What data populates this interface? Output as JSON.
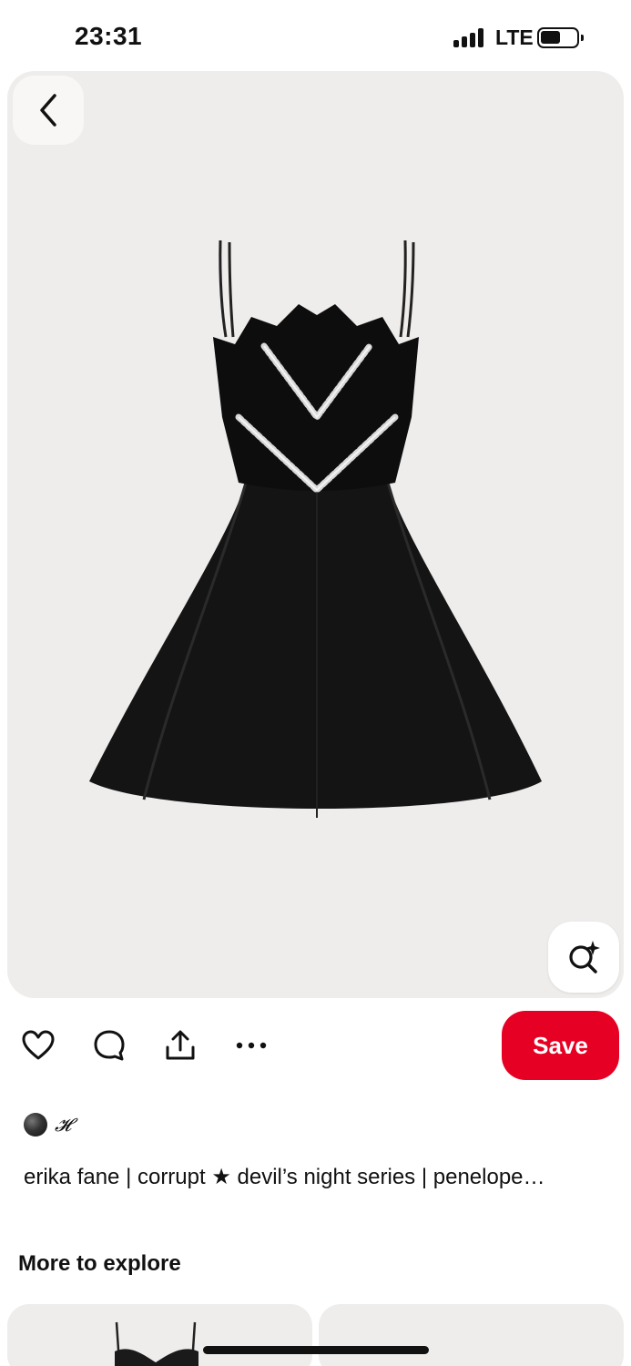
{
  "status_bar": {
    "time": "23:31",
    "network": "LTE",
    "battery_level": 0.55
  },
  "pin": {
    "image_alt": "black mini dress with zigzag bodice and crystal leaf embellishment",
    "author": {
      "name": "𝓗"
    },
    "title": "erika fane | corrupt ★ devil’s night series | penelope…",
    "save_label": "Save"
  },
  "actions": {
    "icons": [
      "heart-icon",
      "comment-icon",
      "share-icon",
      "more-icon"
    ]
  },
  "explore": {
    "heading": "More to explore"
  },
  "colors": {
    "accent": "#e60023",
    "hero_bg": "#efedec"
  }
}
